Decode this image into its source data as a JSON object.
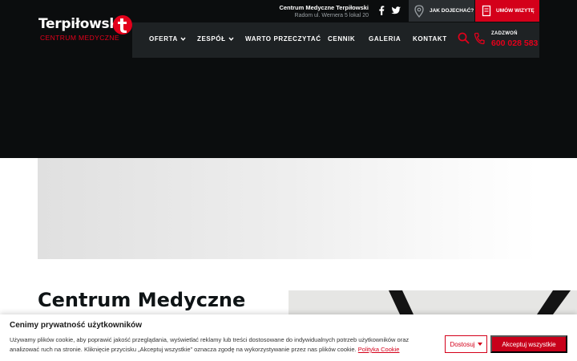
{
  "brand": {
    "name": "Terpiłowski",
    "subtitle": "CENTRUM MEDYCZNE",
    "accent": "#e3001b"
  },
  "topbar": {
    "clinic_name": "Centrum Medyczne Terpiłowski",
    "clinic_address": "Radom ul. Wernera 5 lokal 20",
    "social": [
      "facebook-icon",
      "twitter-icon"
    ],
    "directions_label": "JAK DOJECHAĆ?",
    "appointment_label": "UMÓW WIZYTĘ"
  },
  "nav": {
    "items": [
      {
        "label": "OFERTA",
        "has_dropdown": true
      },
      {
        "label": "ZESPÓŁ",
        "has_dropdown": true
      },
      {
        "label": "WARTO PRZECZYTAĆ",
        "has_dropdown": false
      },
      {
        "label": "CENNIK",
        "has_dropdown": false
      },
      {
        "label": "GALERIA",
        "has_dropdown": false
      },
      {
        "label": "KONTAKT",
        "has_dropdown": false
      }
    ],
    "call_label": "ZADZWOŃ",
    "phone_number": "600 028 583"
  },
  "main": {
    "heading": "Centrum Medyczne"
  },
  "cookie": {
    "title": "Cenimy prywatność użytkowników",
    "text": "Używamy plików cookie, aby poprawić jakość przeglądania, wyświetlać reklamy lub treści dostosowane do indywidualnych potrzeb użytkowników oraz analizować ruch na stronie. Kliknięcie przycisku „Akceptuj wszystkie” oznacza zgodę na wykorzystywanie przez nas plików cookie.",
    "policy_link": "Polityka Cookie",
    "customize_label": "Dostosuj",
    "accept_label": "Akceptuj wszystkie"
  }
}
